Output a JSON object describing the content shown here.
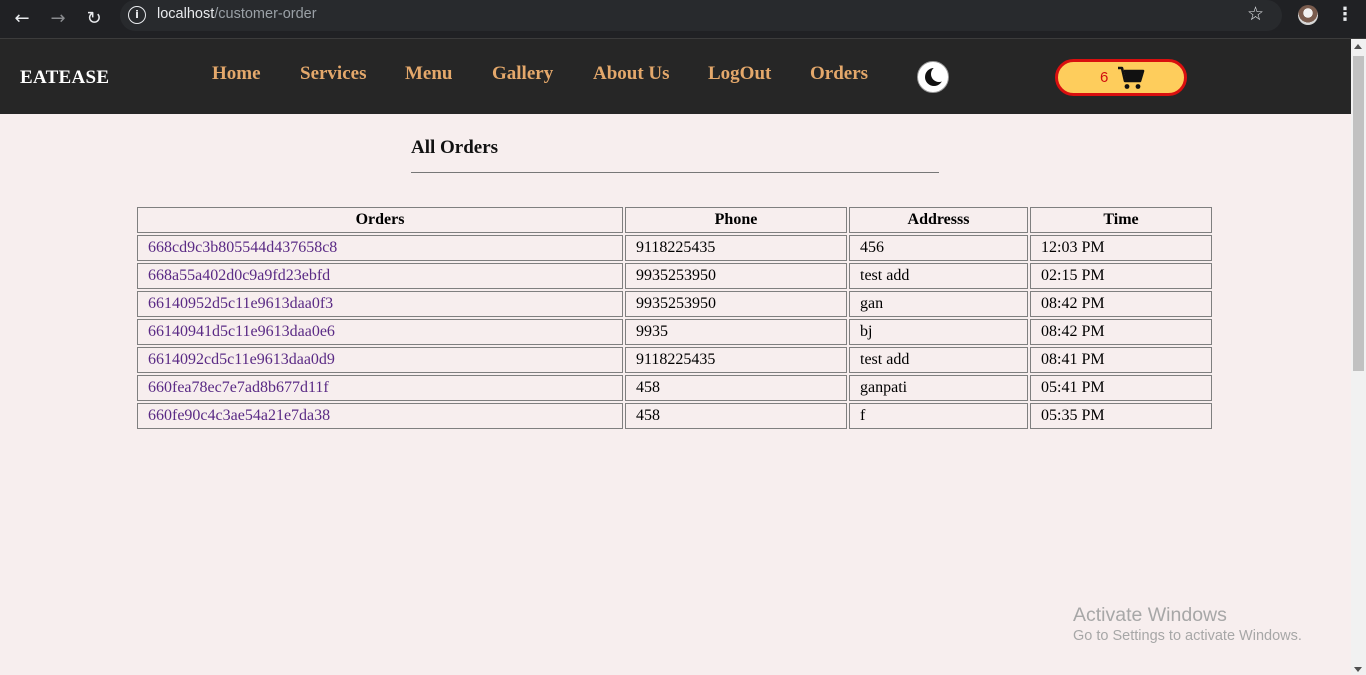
{
  "browser": {
    "url_host": "localhost",
    "url_path": "/customer-order",
    "icons": [
      "back-arrow-icon",
      "forward-arrow-icon",
      "reload-icon",
      "site-info-icon",
      "bookmark-star-icon",
      "profile-avatar",
      "more-menu-icon"
    ]
  },
  "header": {
    "brand": "EATEASE",
    "nav": [
      "Home",
      "Services",
      "Menu",
      "Gallery",
      "About Us",
      "LogOut",
      "Orders"
    ],
    "cart_count": "6",
    "colors": {
      "background": "#262626",
      "nav_link": "#e4a86b",
      "cart_fill": "#fecd5c",
      "cart_border": "#d90f0f"
    }
  },
  "main": {
    "title": "All Orders",
    "table": {
      "headers": [
        "Orders",
        "Phone",
        "Addresss",
        "Time"
      ],
      "rows": [
        [
          "668cd9c3b805544d437658c8",
          "9118225435",
          "456",
          "12:03 PM"
        ],
        [
          "668a55a402d0c9a9fd23ebfd",
          "9935253950",
          "test add",
          "02:15 PM"
        ],
        [
          "66140952d5c11e9613daa0f3",
          "9935253950",
          "gan",
          "08:42 PM"
        ],
        [
          "66140941d5c11e9613daa0e6",
          "9935",
          "bj",
          "08:42 PM"
        ],
        [
          "6614092cd5c11e9613daa0d9",
          "9118225435",
          "test add",
          "08:41 PM"
        ],
        [
          "660fea78ec7e7ad8b677d11f",
          "458",
          "ganpati",
          "05:41 PM"
        ],
        [
          "660fe90c4c3ae54a21e7da38",
          "458",
          "f",
          "05:35 PM"
        ]
      ]
    }
  },
  "watermark": {
    "line1": "Activate Windows",
    "line2": "Go to Settings to activate Windows."
  }
}
